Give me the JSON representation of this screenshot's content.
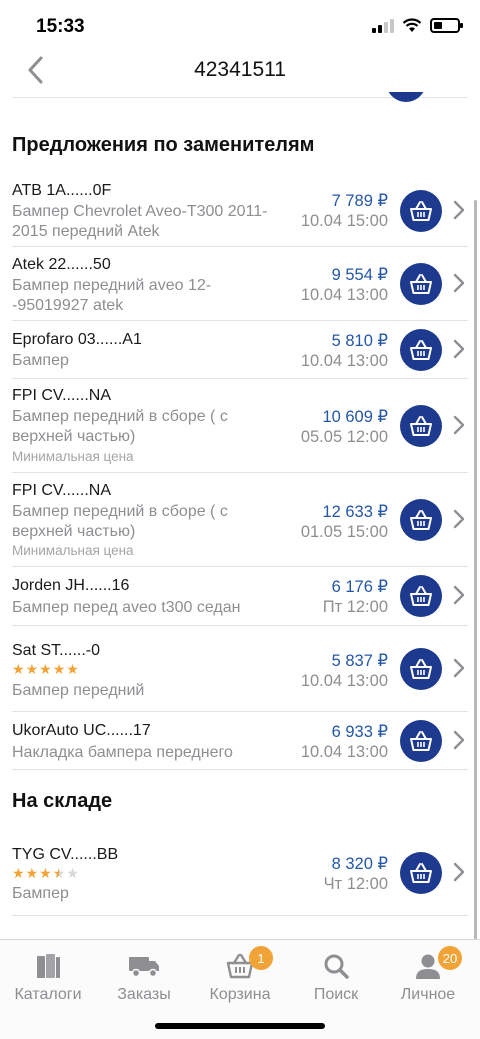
{
  "status": {
    "time": "15:33"
  },
  "header": {
    "title": "42341511"
  },
  "sections": {
    "substitutes_title": "Предложения по заменителям",
    "stock_title": "На складе"
  },
  "substitutes": [
    {
      "name": "ATB 1A......0F",
      "desc": "Бампер Chevrolet Aveo-T300 2011-2015 передний Atek",
      "price": "7 789 ₽",
      "date": "10.04 15:00"
    },
    {
      "name": "Atek 22......50",
      "desc": "Бампер передний aveo 12--95019927 atek",
      "price": "9 554 ₽",
      "date": "10.04 13:00"
    },
    {
      "name": "Eprofaro 03......A1",
      "desc": "Бампер",
      "price": "5 810 ₽",
      "date": "10.04 13:00"
    },
    {
      "name": "FPI CV......NA",
      "desc": "Бампер передний в сборе ( с верхней частью)",
      "note": "Минимальная цена",
      "price": "10 609 ₽",
      "date": "05.05 12:00"
    },
    {
      "name": "FPI CV......NA",
      "desc": "Бампер передний в сборе ( с верхней частью)",
      "note": "Минимальная цена",
      "price": "12 633 ₽",
      "date": "01.05 15:00"
    },
    {
      "name": "Jorden JH......16",
      "desc": "Бампер перед aveo t300 седан",
      "price": "6 176 ₽",
      "date": "Пт 12:00"
    },
    {
      "name": "Sat ST......-0",
      "rating": 5,
      "desc": "Бампер передний",
      "price": "5 837 ₽",
      "date": "10.04 13:00"
    },
    {
      "name": "UkorAuto UC......17",
      "desc": "Накладка бампера переднего",
      "price": "6 933 ₽",
      "date": "10.04 13:00"
    }
  ],
  "stock": [
    {
      "name": "TYG CV......BB",
      "rating": 3.5,
      "desc": "Бампер",
      "price": "8 320 ₽",
      "date": "Чт 12:00"
    }
  ],
  "tabs": [
    {
      "label": "Каталоги",
      "icon": "catalog-icon"
    },
    {
      "label": "Заказы",
      "icon": "truck-icon"
    },
    {
      "label": "Корзина",
      "icon": "basket-icon",
      "badge": "1"
    },
    {
      "label": "Поиск",
      "icon": "search-icon"
    },
    {
      "label": "Личное",
      "icon": "person-icon",
      "badge": "20"
    }
  ],
  "colors": {
    "accent": "#1d3a8f",
    "price": "#2457a8",
    "badge": "#f2a337"
  }
}
